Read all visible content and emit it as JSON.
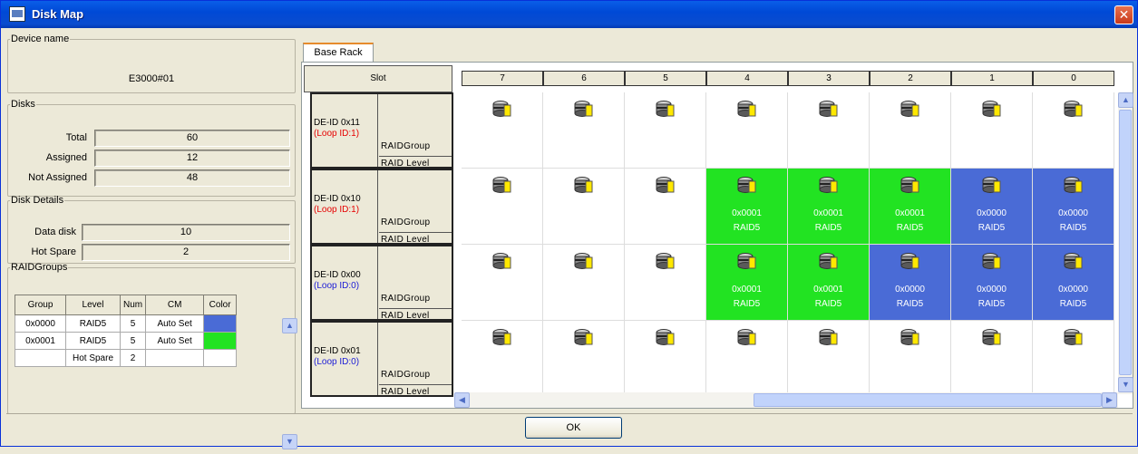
{
  "window": {
    "title": "Disk Map",
    "close": "✕"
  },
  "device": {
    "legend": "Device name",
    "value": "E3000#01"
  },
  "disks": {
    "legend": "Disks",
    "rows": [
      {
        "label": "Total",
        "value": "60"
      },
      {
        "label": "Assigned",
        "value": "12"
      },
      {
        "label": "Not Assigned",
        "value": "48"
      }
    ]
  },
  "details": {
    "legend": "Disk Details",
    "rows": [
      {
        "label": "Data disk",
        "value": "10"
      },
      {
        "label": "Hot Spare",
        "value": "2"
      }
    ]
  },
  "raidgroups": {
    "legend": "RAIDGroups",
    "headers": [
      "Group",
      "Level",
      "Num",
      "CM",
      "Color"
    ],
    "rows": [
      {
        "group": "0x0000",
        "level": "RAID5",
        "num": "5",
        "cm": "Auto Set",
        "color": "#4a6bd6"
      },
      {
        "group": "0x0001",
        "level": "RAID5",
        "num": "5",
        "cm": "Auto Set",
        "color": "#22e322"
      },
      {
        "group": "",
        "level": "Hot Spare",
        "num": "2",
        "cm": "",
        "color": ""
      }
    ]
  },
  "tab": {
    "label": "Base Rack"
  },
  "slot_label": "Slot",
  "columns": [
    "7",
    "6",
    "5",
    "4",
    "3",
    "2",
    "1",
    "0"
  ],
  "rows": [
    {
      "de": "DE-ID 0x11",
      "loop": "(Loop ID:1)",
      "loop_color": "#e60000",
      "rg": "RAIDGroup",
      "rl": "RAID Level"
    },
    {
      "de": "DE-ID 0x10",
      "loop": "(Loop ID:1)",
      "loop_color": "#e60000",
      "rg": "RAIDGroup",
      "rl": "RAID Level"
    },
    {
      "de": "DE-ID 0x00",
      "loop": "(Loop ID:0)",
      "loop_color": "#1a1ad6",
      "rg": "RAIDGroup",
      "rl": "RAID Level"
    },
    {
      "de": "DE-ID 0x01",
      "loop": "(Loop ID:0)",
      "loop_color": "#1a1ad6",
      "rg": "RAIDGroup",
      "rl": "RAID Level"
    }
  ],
  "cells": [
    [
      {},
      {},
      {},
      {},
      {},
      {},
      {},
      {}
    ],
    [
      {},
      {},
      {},
      {
        "id": "0x0001",
        "level": "RAID5",
        "bg": "#22e322"
      },
      {
        "id": "0x0001",
        "level": "RAID5",
        "bg": "#22e322"
      },
      {
        "id": "0x0001",
        "level": "RAID5",
        "bg": "#22e322"
      },
      {
        "id": "0x0000",
        "level": "RAID5",
        "bg": "#4a6bd6"
      },
      {
        "id": "0x0000",
        "level": "RAID5",
        "bg": "#4a6bd6"
      }
    ],
    [
      {},
      {},
      {},
      {
        "id": "0x0001",
        "level": "RAID5",
        "bg": "#22e322"
      },
      {
        "id": "0x0001",
        "level": "RAID5",
        "bg": "#22e322"
      },
      {
        "id": "0x0000",
        "level": "RAID5",
        "bg": "#4a6bd6"
      },
      {
        "id": "0x0000",
        "level": "RAID5",
        "bg": "#4a6bd6"
      },
      {
        "id": "0x0000",
        "level": "RAID5",
        "bg": "#4a6bd6"
      }
    ],
    [
      {},
      {},
      {},
      {},
      {},
      {},
      {},
      {}
    ]
  ],
  "ok_label": "OK"
}
